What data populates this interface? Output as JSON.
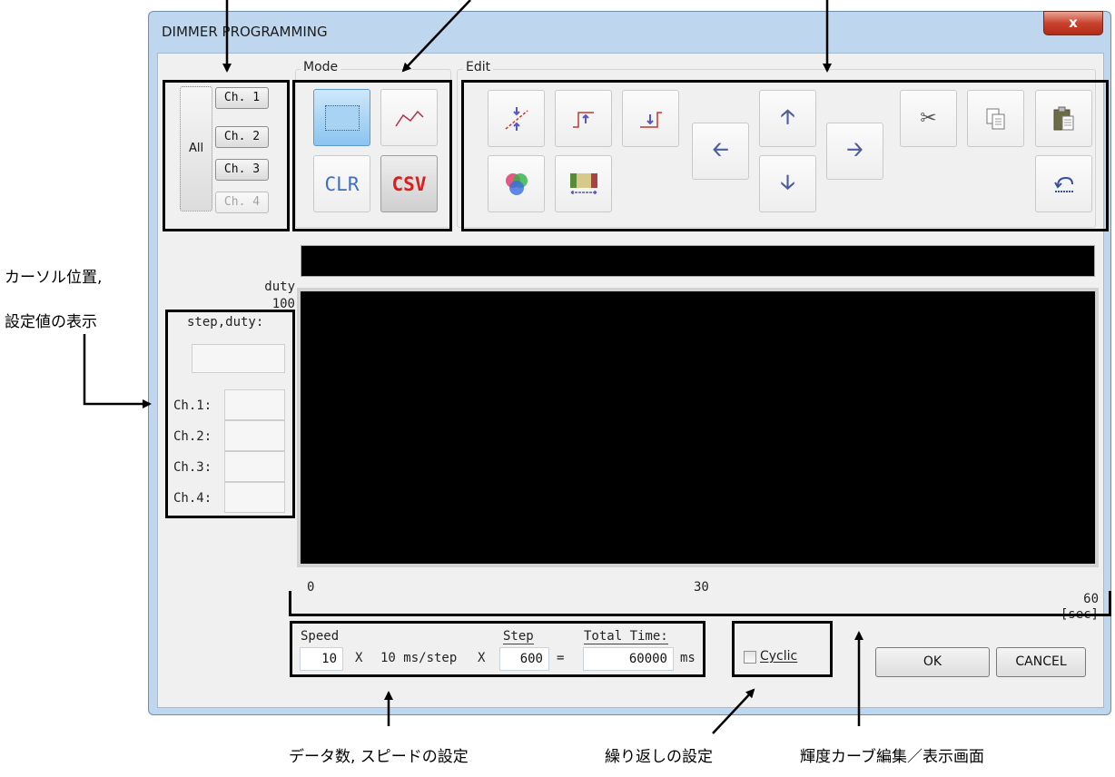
{
  "window": {
    "title": "DIMMER PROGRAMMING",
    "close_glyph": "x"
  },
  "channels": {
    "all_label": "All",
    "buttons": [
      "Ch. 1",
      "Ch. 2",
      "Ch. 3",
      "Ch. 4"
    ]
  },
  "mode": {
    "label": "Mode",
    "clr_label": "CLR",
    "csv_label": "CSV",
    "clr_color": "#3d6fc1",
    "csv_color": "#d81e1e"
  },
  "edit": {
    "label": "Edit"
  },
  "cursor_panel": {
    "step_duty_label": "step,duty:",
    "channel_labels": [
      "Ch.1:",
      "Ch.2:",
      "Ch.3:",
      "Ch.4:"
    ]
  },
  "graph": {
    "y_label": "duty",
    "y_max": "100",
    "x_ticks": [
      "0",
      "30",
      "60"
    ],
    "x_unit": "[sec]"
  },
  "settings": {
    "speed_label": "Speed",
    "speed_value": "10",
    "times1": "X",
    "ms_per_step": "10 ms/step",
    "times2": "X",
    "step_label": "Step",
    "step_value": "600",
    "equals": "=",
    "total_label": "Total Time:",
    "total_value": "60000",
    "ms_unit": "ms"
  },
  "cyclic": {
    "label": "Cyclic",
    "checked": false
  },
  "dialog_buttons": {
    "ok": "OK",
    "cancel": "CANCEL"
  },
  "annotations": {
    "cursor_display_line1": "カーソル位置,",
    "cursor_display_line2": "設定値の表示",
    "data_speed": "データ数, スピードの設定",
    "repeat": "繰り返しの設定",
    "curve_editor": "輝度カーブ編集／表示画面"
  }
}
